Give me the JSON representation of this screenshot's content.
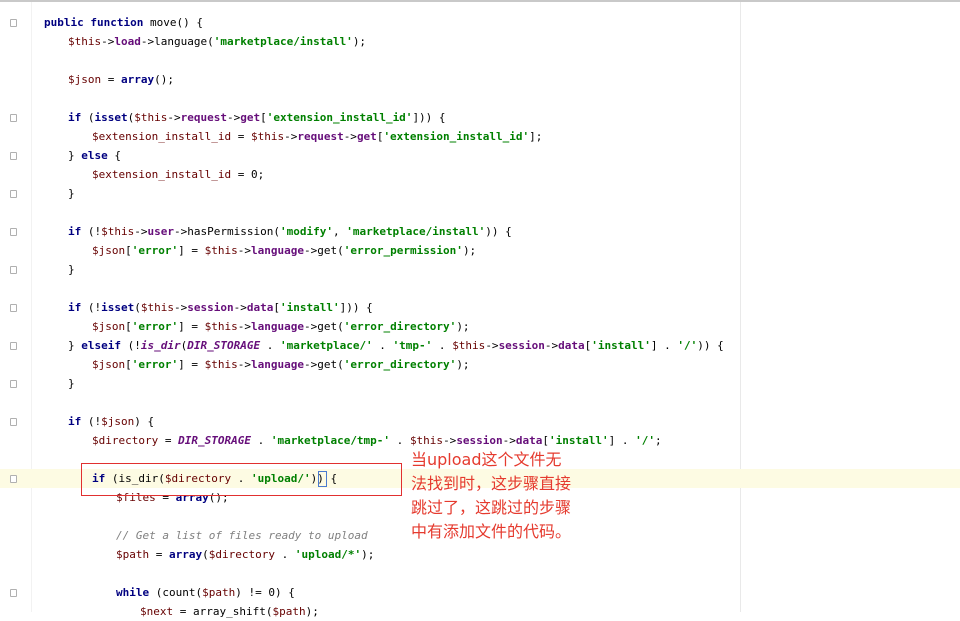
{
  "editor": {
    "lines": [
      {
        "indent": 0,
        "tokens": [
          [
            "kw",
            "public function "
          ],
          [
            "fn",
            "move"
          ],
          [
            "plain",
            "() {"
          ]
        ]
      },
      {
        "indent": 1,
        "tokens": [
          [
            "var",
            "$this"
          ],
          [
            "plain",
            "->"
          ],
          [
            "prop",
            "load"
          ],
          [
            "plain",
            "->"
          ],
          [
            "fn",
            "language"
          ],
          [
            "plain",
            "("
          ],
          [
            "str",
            "'marketplace/install'"
          ],
          [
            "plain",
            ");"
          ]
        ]
      },
      {
        "indent": 1,
        "tokens": []
      },
      {
        "indent": 1,
        "tokens": [
          [
            "var",
            "$json"
          ],
          [
            "plain",
            " = "
          ],
          [
            "kw",
            "array"
          ],
          [
            "plain",
            "();"
          ]
        ]
      },
      {
        "indent": 1,
        "tokens": []
      },
      {
        "indent": 1,
        "tokens": [
          [
            "kw",
            "if "
          ],
          [
            "plain",
            "("
          ],
          [
            "kw",
            "isset"
          ],
          [
            "plain",
            "("
          ],
          [
            "var",
            "$this"
          ],
          [
            "plain",
            "->"
          ],
          [
            "prop",
            "request"
          ],
          [
            "plain",
            "->"
          ],
          [
            "prop",
            "get"
          ],
          [
            "plain",
            "["
          ],
          [
            "str",
            "'extension_install_id'"
          ],
          [
            "plain",
            "])) {"
          ]
        ]
      },
      {
        "indent": 2,
        "tokens": [
          [
            "var",
            "$extension_install_id"
          ],
          [
            "plain",
            " = "
          ],
          [
            "var",
            "$this"
          ],
          [
            "plain",
            "->"
          ],
          [
            "prop",
            "request"
          ],
          [
            "plain",
            "->"
          ],
          [
            "prop",
            "get"
          ],
          [
            "plain",
            "["
          ],
          [
            "str",
            "'extension_install_id'"
          ],
          [
            "plain",
            "];"
          ]
        ]
      },
      {
        "indent": 1,
        "tokens": [
          [
            "plain",
            "} "
          ],
          [
            "kw",
            "else"
          ],
          [
            "plain",
            " {"
          ]
        ]
      },
      {
        "indent": 2,
        "tokens": [
          [
            "var",
            "$extension_install_id"
          ],
          [
            "plain",
            " = 0;"
          ]
        ]
      },
      {
        "indent": 1,
        "tokens": [
          [
            "plain",
            "}"
          ]
        ]
      },
      {
        "indent": 1,
        "tokens": []
      },
      {
        "indent": 1,
        "tokens": [
          [
            "kw",
            "if "
          ],
          [
            "plain",
            "(!"
          ],
          [
            "var",
            "$this"
          ],
          [
            "plain",
            "->"
          ],
          [
            "prop",
            "user"
          ],
          [
            "plain",
            "->"
          ],
          [
            "fn",
            "hasPermission"
          ],
          [
            "plain",
            "("
          ],
          [
            "str",
            "'modify'"
          ],
          [
            "plain",
            ", "
          ],
          [
            "str",
            "'marketplace/install'"
          ],
          [
            "plain",
            ")) {"
          ]
        ]
      },
      {
        "indent": 2,
        "tokens": [
          [
            "var",
            "$json"
          ],
          [
            "plain",
            "["
          ],
          [
            "str",
            "'error'"
          ],
          [
            "plain",
            "] = "
          ],
          [
            "var",
            "$this"
          ],
          [
            "plain",
            "->"
          ],
          [
            "prop",
            "language"
          ],
          [
            "plain",
            "->"
          ],
          [
            "fn",
            "get"
          ],
          [
            "plain",
            "("
          ],
          [
            "str",
            "'error_permission'"
          ],
          [
            "plain",
            ");"
          ]
        ]
      },
      {
        "indent": 1,
        "tokens": [
          [
            "plain",
            "}"
          ]
        ]
      },
      {
        "indent": 1,
        "tokens": []
      },
      {
        "indent": 1,
        "tokens": [
          [
            "kw",
            "if "
          ],
          [
            "plain",
            "(!"
          ],
          [
            "kw",
            "isset"
          ],
          [
            "plain",
            "("
          ],
          [
            "var",
            "$this"
          ],
          [
            "plain",
            "->"
          ],
          [
            "prop",
            "session"
          ],
          [
            "plain",
            "->"
          ],
          [
            "prop",
            "data"
          ],
          [
            "plain",
            "["
          ],
          [
            "str",
            "'install'"
          ],
          [
            "plain",
            "])) {"
          ]
        ]
      },
      {
        "indent": 2,
        "tokens": [
          [
            "var",
            "$json"
          ],
          [
            "plain",
            "["
          ],
          [
            "str",
            "'error'"
          ],
          [
            "plain",
            "] = "
          ],
          [
            "var",
            "$this"
          ],
          [
            "plain",
            "->"
          ],
          [
            "prop",
            "language"
          ],
          [
            "plain",
            "->"
          ],
          [
            "fn",
            "get"
          ],
          [
            "plain",
            "("
          ],
          [
            "str",
            "'error_directory'"
          ],
          [
            "plain",
            ");"
          ]
        ]
      },
      {
        "indent": 1,
        "tokens": [
          [
            "plain",
            "} "
          ],
          [
            "kw",
            "elseif "
          ],
          [
            "plain",
            "(!"
          ],
          [
            "const",
            "is_dir"
          ],
          [
            "plain",
            "("
          ],
          [
            "const",
            "DIR_STORAGE"
          ],
          [
            "plain",
            " . "
          ],
          [
            "str",
            "'marketplace/'"
          ],
          [
            "plain",
            " . "
          ],
          [
            "str",
            "'tmp-'"
          ],
          [
            "plain",
            " . "
          ],
          [
            "var",
            "$this"
          ],
          [
            "plain",
            "->"
          ],
          [
            "prop",
            "session"
          ],
          [
            "plain",
            "->"
          ],
          [
            "prop",
            "data"
          ],
          [
            "plain",
            "["
          ],
          [
            "str",
            "'install'"
          ],
          [
            "plain",
            "] . "
          ],
          [
            "str",
            "'/'"
          ],
          [
            "plain",
            ")) {"
          ]
        ]
      },
      {
        "indent": 2,
        "tokens": [
          [
            "var",
            "$json"
          ],
          [
            "plain",
            "["
          ],
          [
            "str",
            "'error'"
          ],
          [
            "plain",
            "] = "
          ],
          [
            "var",
            "$this"
          ],
          [
            "plain",
            "->"
          ],
          [
            "prop",
            "language"
          ],
          [
            "plain",
            "->"
          ],
          [
            "fn",
            "get"
          ],
          [
            "plain",
            "("
          ],
          [
            "str",
            "'error_directory'"
          ],
          [
            "plain",
            ");"
          ]
        ]
      },
      {
        "indent": 1,
        "tokens": [
          [
            "plain",
            "}"
          ]
        ]
      },
      {
        "indent": 1,
        "tokens": []
      },
      {
        "indent": 1,
        "tokens": [
          [
            "kw",
            "if "
          ],
          [
            "plain",
            "(!"
          ],
          [
            "var",
            "$json"
          ],
          [
            "plain",
            ") {"
          ]
        ]
      },
      {
        "indent": 2,
        "tokens": [
          [
            "var",
            "$directory"
          ],
          [
            "plain",
            " = "
          ],
          [
            "const",
            "DIR_STORAGE"
          ],
          [
            "plain",
            " . "
          ],
          [
            "str",
            "'marketplace/tmp-'"
          ],
          [
            "plain",
            " . "
          ],
          [
            "var",
            "$this"
          ],
          [
            "plain",
            "->"
          ],
          [
            "prop",
            "session"
          ],
          [
            "plain",
            "->"
          ],
          [
            "prop",
            "data"
          ],
          [
            "plain",
            "["
          ],
          [
            "str",
            "'install'"
          ],
          [
            "plain",
            "] . "
          ],
          [
            "str",
            "'/'"
          ],
          [
            "plain",
            ";"
          ]
        ]
      },
      {
        "indent": 2,
        "tokens": []
      },
      {
        "indent": 2,
        "tokens": [
          [
            "kw",
            "if "
          ],
          [
            "plain",
            "("
          ],
          [
            "fn",
            "is_dir"
          ],
          [
            "plain",
            "("
          ],
          [
            "var",
            "$directory"
          ],
          [
            "plain",
            " . "
          ],
          [
            "str",
            "'upload/'"
          ],
          [
            "plain",
            ")) {"
          ]
        ]
      },
      {
        "indent": 3,
        "tokens": [
          [
            "var",
            "$files"
          ],
          [
            "plain",
            " = "
          ],
          [
            "kw",
            "array"
          ],
          [
            "plain",
            "();"
          ]
        ]
      },
      {
        "indent": 3,
        "tokens": []
      },
      {
        "indent": 3,
        "tokens": [
          [
            "cm",
            "// Get a list of files ready to upload"
          ]
        ]
      },
      {
        "indent": 3,
        "tokens": [
          [
            "var",
            "$path"
          ],
          [
            "plain",
            " = "
          ],
          [
            "kw",
            "array"
          ],
          [
            "plain",
            "("
          ],
          [
            "var",
            "$directory"
          ],
          [
            "plain",
            " . "
          ],
          [
            "str",
            "'upload/*'"
          ],
          [
            "plain",
            ");"
          ]
        ]
      },
      {
        "indent": 3,
        "tokens": []
      },
      {
        "indent": 3,
        "tokens": [
          [
            "kw",
            "while "
          ],
          [
            "plain",
            "("
          ],
          [
            "fn",
            "count"
          ],
          [
            "plain",
            "("
          ],
          [
            "var",
            "$path"
          ],
          [
            "plain",
            ") != 0) {"
          ]
        ]
      },
      {
        "indent": 4,
        "tokens": [
          [
            "var",
            "$next"
          ],
          [
            "plain",
            " = "
          ],
          [
            "fn",
            "array_shift"
          ],
          [
            "plain",
            "("
          ],
          [
            "var",
            "$path"
          ],
          [
            "plain",
            ");"
          ]
        ]
      }
    ]
  },
  "annotation": {
    "text": "当upload这个文件无法找到时，这步骤直接跳过了，这跳过的步骤中有添加文件的代码。",
    "color": "#e53a2e"
  },
  "colors": {
    "keyword": "#000080",
    "string": "#008000",
    "variable": "#660000",
    "property": "#660e7a",
    "highlight_row": "#fdfbe3",
    "highlight_box": "#e13030"
  }
}
